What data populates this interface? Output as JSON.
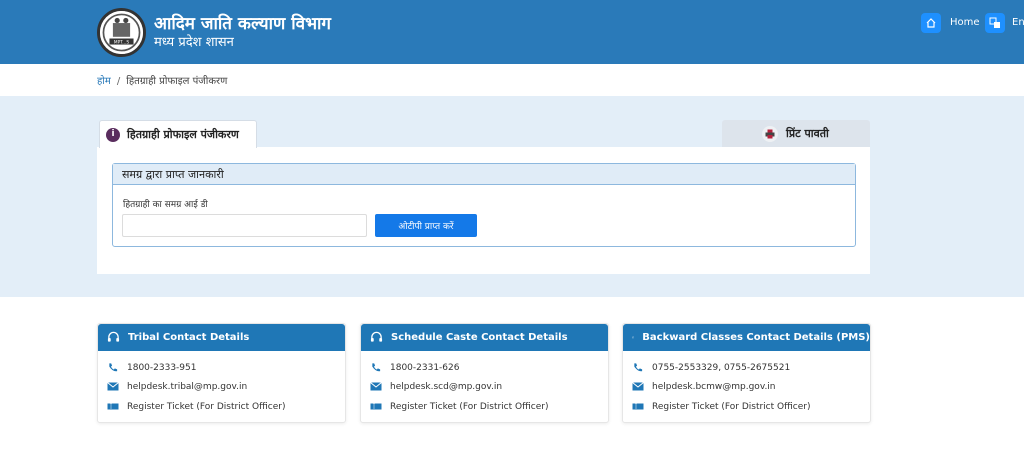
{
  "header": {
    "title": "आदिम जाति कल्याण विभाग",
    "subtitle": "मध्य प्रदेश शासन",
    "logo_icon": "state-emblem-logo",
    "logo_text": "MPT...S",
    "nav": {
      "home_label": "Home",
      "home_icon": "home-icon",
      "lang_label": "En",
      "lang_icon": "language-icon"
    }
  },
  "breadcrumb": {
    "home": "होम",
    "separator": "/",
    "current": "हितग्राही प्रोफाइल पंजीकरण"
  },
  "tabs": {
    "active": {
      "label": "हितग्राही प्रोफाइल पंजीकरण",
      "icon": "info-icon",
      "icon_glyph": "i"
    },
    "print": {
      "label": "प्रिंट पावती",
      "icon": "printer-icon"
    }
  },
  "form": {
    "section_title": "समग्र द्वारा प्राप्त जानकारी",
    "samagra_label": "हितग्राही का समग्र आई डी",
    "samagra_value": "",
    "otp_button": "ओटीपी प्राप्त करें"
  },
  "contacts": [
    {
      "title": "Tribal Contact Details",
      "phone": "1800-2333-951",
      "email": "helpdesk.tribal@mp.gov.in",
      "ticket": "Register Ticket (For District Officer)"
    },
    {
      "title": "Schedule Caste Contact Details",
      "phone": "1800-2331-626",
      "email": "helpdesk.scd@mp.gov.in",
      "ticket": "Register Ticket (For District Officer)"
    },
    {
      "title": "Backward Classes Contact Details (PMS)",
      "phone": "0755-2553329, 0755-2675521",
      "email": "helpdesk.bcmw@mp.gov.in",
      "ticket": "Register Ticket (For District Officer)"
    }
  ],
  "colors": {
    "header_blue": "#2a7ab9",
    "band_bg": "#e3eef8",
    "button_blue": "#1479e8",
    "contact_header": "#1f77b6"
  }
}
